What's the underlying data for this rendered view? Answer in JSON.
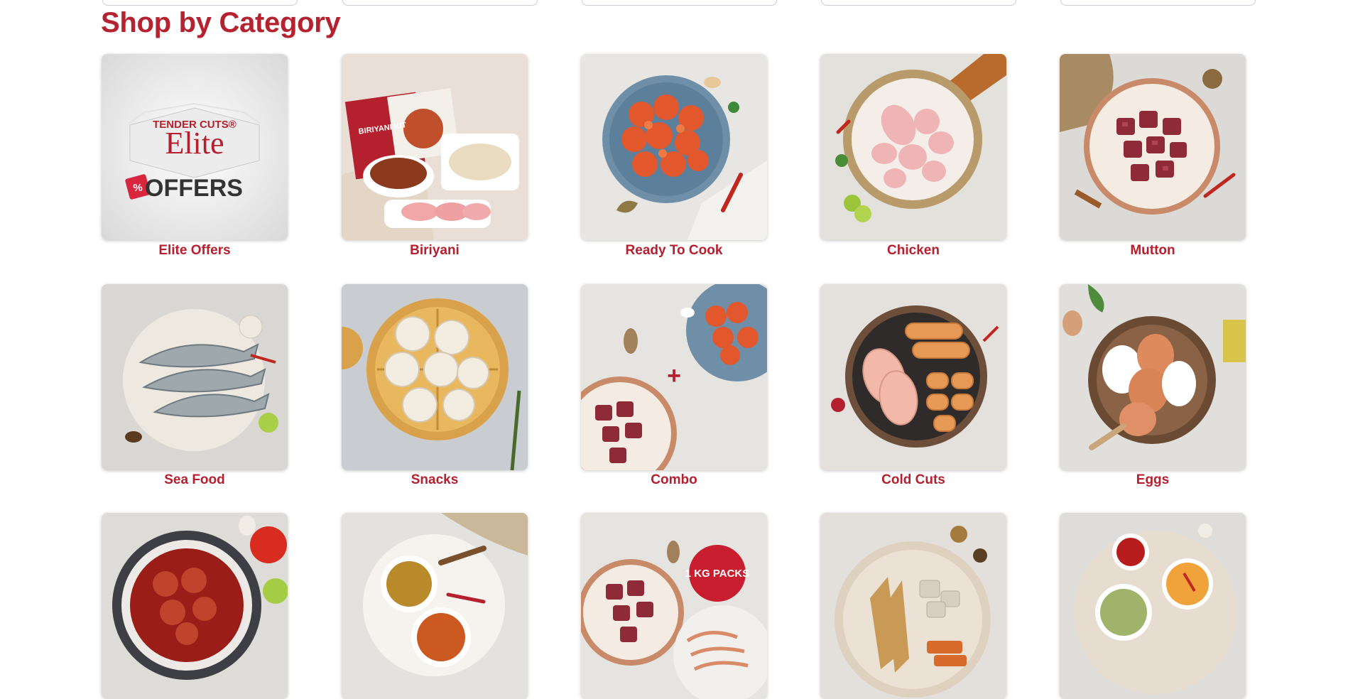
{
  "section": {
    "title": "Shop by Category"
  },
  "categories": [
    {
      "label": "Elite Offers",
      "icon": "elite-offers-image",
      "logo_top": "TENDER CUTS®",
      "logo_main": "Elite",
      "logo_sub": "OFFERS"
    },
    {
      "label": "Biriyani",
      "icon": "biriyani-kit-image",
      "kit_text": "BIRIYANI KIT"
    },
    {
      "label": "Ready To Cook",
      "icon": "marinated-chicken-image"
    },
    {
      "label": "Chicken",
      "icon": "raw-chicken-image"
    },
    {
      "label": "Mutton",
      "icon": "mutton-cubes-image"
    },
    {
      "label": "Sea Food",
      "icon": "fish-image"
    },
    {
      "label": "Snacks",
      "icon": "momos-image"
    },
    {
      "label": "Combo",
      "icon": "combo-image"
    },
    {
      "label": "Cold Cuts",
      "icon": "cold-cuts-image"
    },
    {
      "label": "Eggs",
      "icon": "eggs-image"
    },
    {
      "label": "",
      "icon": "curry-image"
    },
    {
      "label": "",
      "icon": "spices-image"
    },
    {
      "label": "",
      "icon": "bulk-packs-image",
      "badge": "1 KG PACKS"
    },
    {
      "label": "",
      "icon": "dry-fish-image"
    },
    {
      "label": "",
      "icon": "dips-image"
    }
  ],
  "colors": {
    "brand_red": "#b51f2e",
    "title_red": "#b52330",
    "border": "#c7ccd6"
  }
}
